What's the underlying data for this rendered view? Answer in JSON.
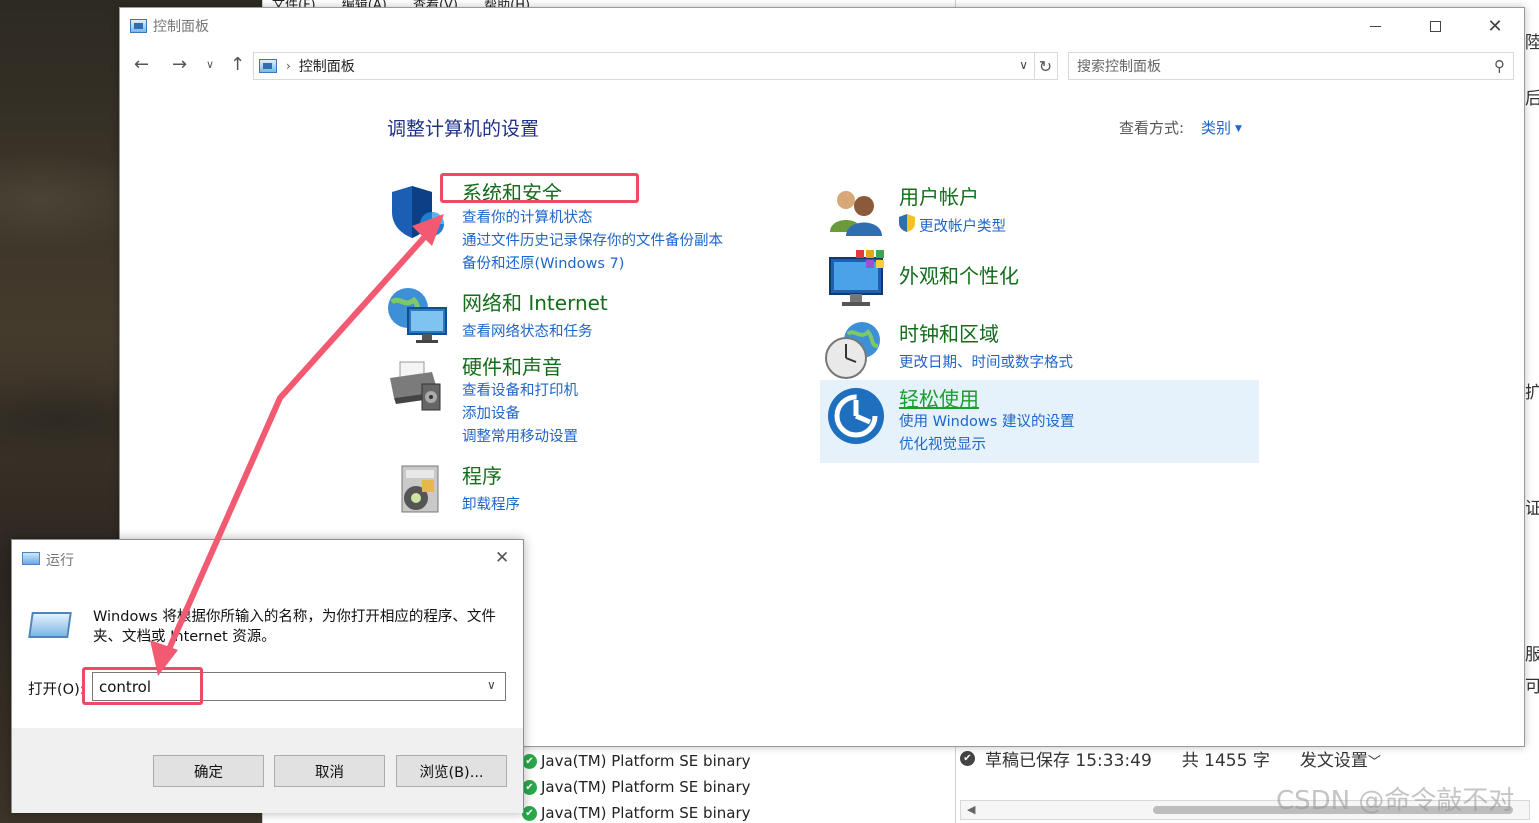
{
  "background_app": {
    "menu": [
      "文件(F)",
      "编辑(A)",
      "查看(V)",
      "帮助(H)"
    ],
    "list_items": [
      "Java(TM) Platform SE binary",
      "Java(TM) Platform SE binary",
      "Java(TM) Platform SE binary"
    ],
    "status": {
      "saved": "草稿已保存 15:33:49",
      "word_count": "共 1455 字",
      "publish": "发文设置"
    },
    "edge_chars": [
      "陸",
      "后",
      "扩",
      "证",
      "服",
      "可"
    ],
    "watermark": "CSDN @命令敲不对"
  },
  "control_panel": {
    "window_title": "控制面板",
    "breadcrumb": "控制面板",
    "search_placeholder": "搜索控制面板",
    "heading": "调整计算机的设置",
    "view_mode_label": "查看方式:",
    "view_mode_value": "类别",
    "categories": {
      "system_security": {
        "title": "系统和安全",
        "links": [
          "查看你的计算机状态",
          "通过文件历史记录保存你的文件备份副本",
          "备份和还原(Windows 7)"
        ]
      },
      "network": {
        "title": "网络和 Internet",
        "links": [
          "查看网络状态和任务"
        ]
      },
      "hardware": {
        "title": "硬件和声音",
        "links": [
          "查看设备和打印机",
          "添加设备",
          "调整常用移动设置"
        ]
      },
      "programs": {
        "title": "程序",
        "links": [
          "卸载程序"
        ]
      },
      "user_accounts": {
        "title": "用户帐户",
        "links": [
          "更改帐户类型"
        ]
      },
      "appearance": {
        "title": "外观和个性化",
        "links": []
      },
      "clock_region": {
        "title": "时钟和区域",
        "links": [
          "更改日期、时间或数字格式"
        ]
      },
      "ease_of_access": {
        "title": "轻松使用",
        "links": [
          "使用 Windows 建议的设置",
          "优化视觉显示"
        ]
      }
    }
  },
  "run_dialog": {
    "title": "运行",
    "description": "Windows 将根据你所输入的名称，为你打开相应的程序、文件夹、文档或 Internet 资源。",
    "open_label": "打开(O):",
    "input_value": "control",
    "buttons": {
      "ok": "确定",
      "cancel": "取消",
      "browse": "浏览(B)..."
    }
  },
  "colors": {
    "annotation": "#ef4a63",
    "category_title": "#136d1b",
    "link": "#1e66c8",
    "heading": "#1e3287",
    "hover_bg": "#e5f1fb"
  }
}
